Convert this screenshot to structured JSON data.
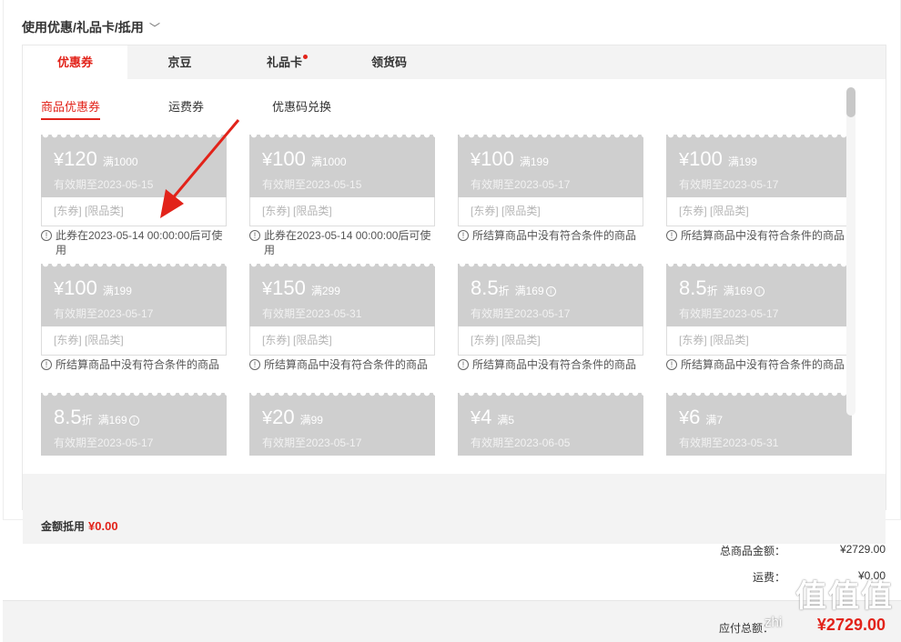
{
  "section": {
    "title": "使用优惠/礼品卡/抵用",
    "chevron": "︿"
  },
  "tabs": [
    {
      "label": "优惠券",
      "active": true
    },
    {
      "label": "京豆"
    },
    {
      "label": "礼品卡",
      "dot": true
    },
    {
      "label": "领货码"
    }
  ],
  "subtabs": [
    {
      "label": "商品优惠券",
      "active": true
    },
    {
      "label": "运费券"
    },
    {
      "label": "优惠码兑换"
    }
  ],
  "coupons": [
    {
      "cur": "¥",
      "amount": "120",
      "cond": "满1000",
      "expiry": "有效期至2023-05-15",
      "tags": "[东券] [限品类]",
      "note": "此券在2023-05-14 00:00:00后可使用"
    },
    {
      "cur": "¥",
      "amount": "100",
      "cond": "满1000",
      "expiry": "有效期至2023-05-15",
      "tags": "[东券] [限品类]",
      "note": "此券在2023-05-14 00:00:00后可使用"
    },
    {
      "cur": "¥",
      "amount": "100",
      "cond": "满199",
      "expiry": "有效期至2023-05-17",
      "tags": "[东券] [限品类]",
      "note": "所结算商品中没有符合条件的商品"
    },
    {
      "cur": "¥",
      "amount": "100",
      "cond": "满199",
      "expiry": "有效期至2023-05-17",
      "tags": "[东券] [限品类]",
      "note": "所结算商品中没有符合条件的商品"
    },
    {
      "cur": "¥",
      "amount": "100",
      "cond": "满199",
      "expiry": "有效期至2023-05-17",
      "tags": "[东券] [限品类]",
      "note": "所结算商品中没有符合条件的商品"
    },
    {
      "cur": "¥",
      "amount": "150",
      "cond": "满299",
      "expiry": "有效期至2023-05-31",
      "tags": "[东券] [限品类]",
      "note": "所结算商品中没有符合条件的商品"
    },
    {
      "amount": "8.5",
      "unit": "折",
      "cond": "满169",
      "info": "i",
      "expiry": "有效期至2023-05-17",
      "tags": "[东券] [限品类]",
      "note": "所结算商品中没有符合条件的商品"
    },
    {
      "amount": "8.5",
      "unit": "折",
      "cond": "满169",
      "info": "i",
      "expiry": "有效期至2023-05-17",
      "tags": "[东券] [限品类]",
      "note": "所结算商品中没有符合条件的商品"
    },
    {
      "amount": "8.5",
      "unit": "折",
      "cond": "满169",
      "info": "i",
      "expiry": "有效期至2023-05-17",
      "tags": "",
      "note": ""
    },
    {
      "cur": "¥",
      "amount": "20",
      "cond": "满99",
      "expiry": "有效期至2023-05-17",
      "tags": "",
      "note": ""
    },
    {
      "cur": "¥",
      "amount": "4",
      "cond": "满5",
      "expiry": "有效期至2023-06-05",
      "tags": "",
      "note": ""
    },
    {
      "cur": "¥",
      "amount": "6",
      "cond": "满7",
      "expiry": "有效期至2023-05-31",
      "tags": "",
      "note": ""
    }
  ],
  "deduction": {
    "label": "金额抵用",
    "value": "¥0.00"
  },
  "summary": {
    "goods_label": "总商品金额：",
    "goods_value": "¥2729.00",
    "shipping_label": "运费：",
    "shipping_value": "¥0.00",
    "pay_label": "应付总额：",
    "pay_value": "¥2729.00"
  },
  "watermark": {
    "text": "值值值",
    "url": "zhi"
  },
  "colors": {
    "accent": "#e2231a",
    "coupon_disabled": "#cfcfcf"
  },
  "icons": {
    "note": "info-circle-icon",
    "arrow": "red-arrow-annotation"
  }
}
